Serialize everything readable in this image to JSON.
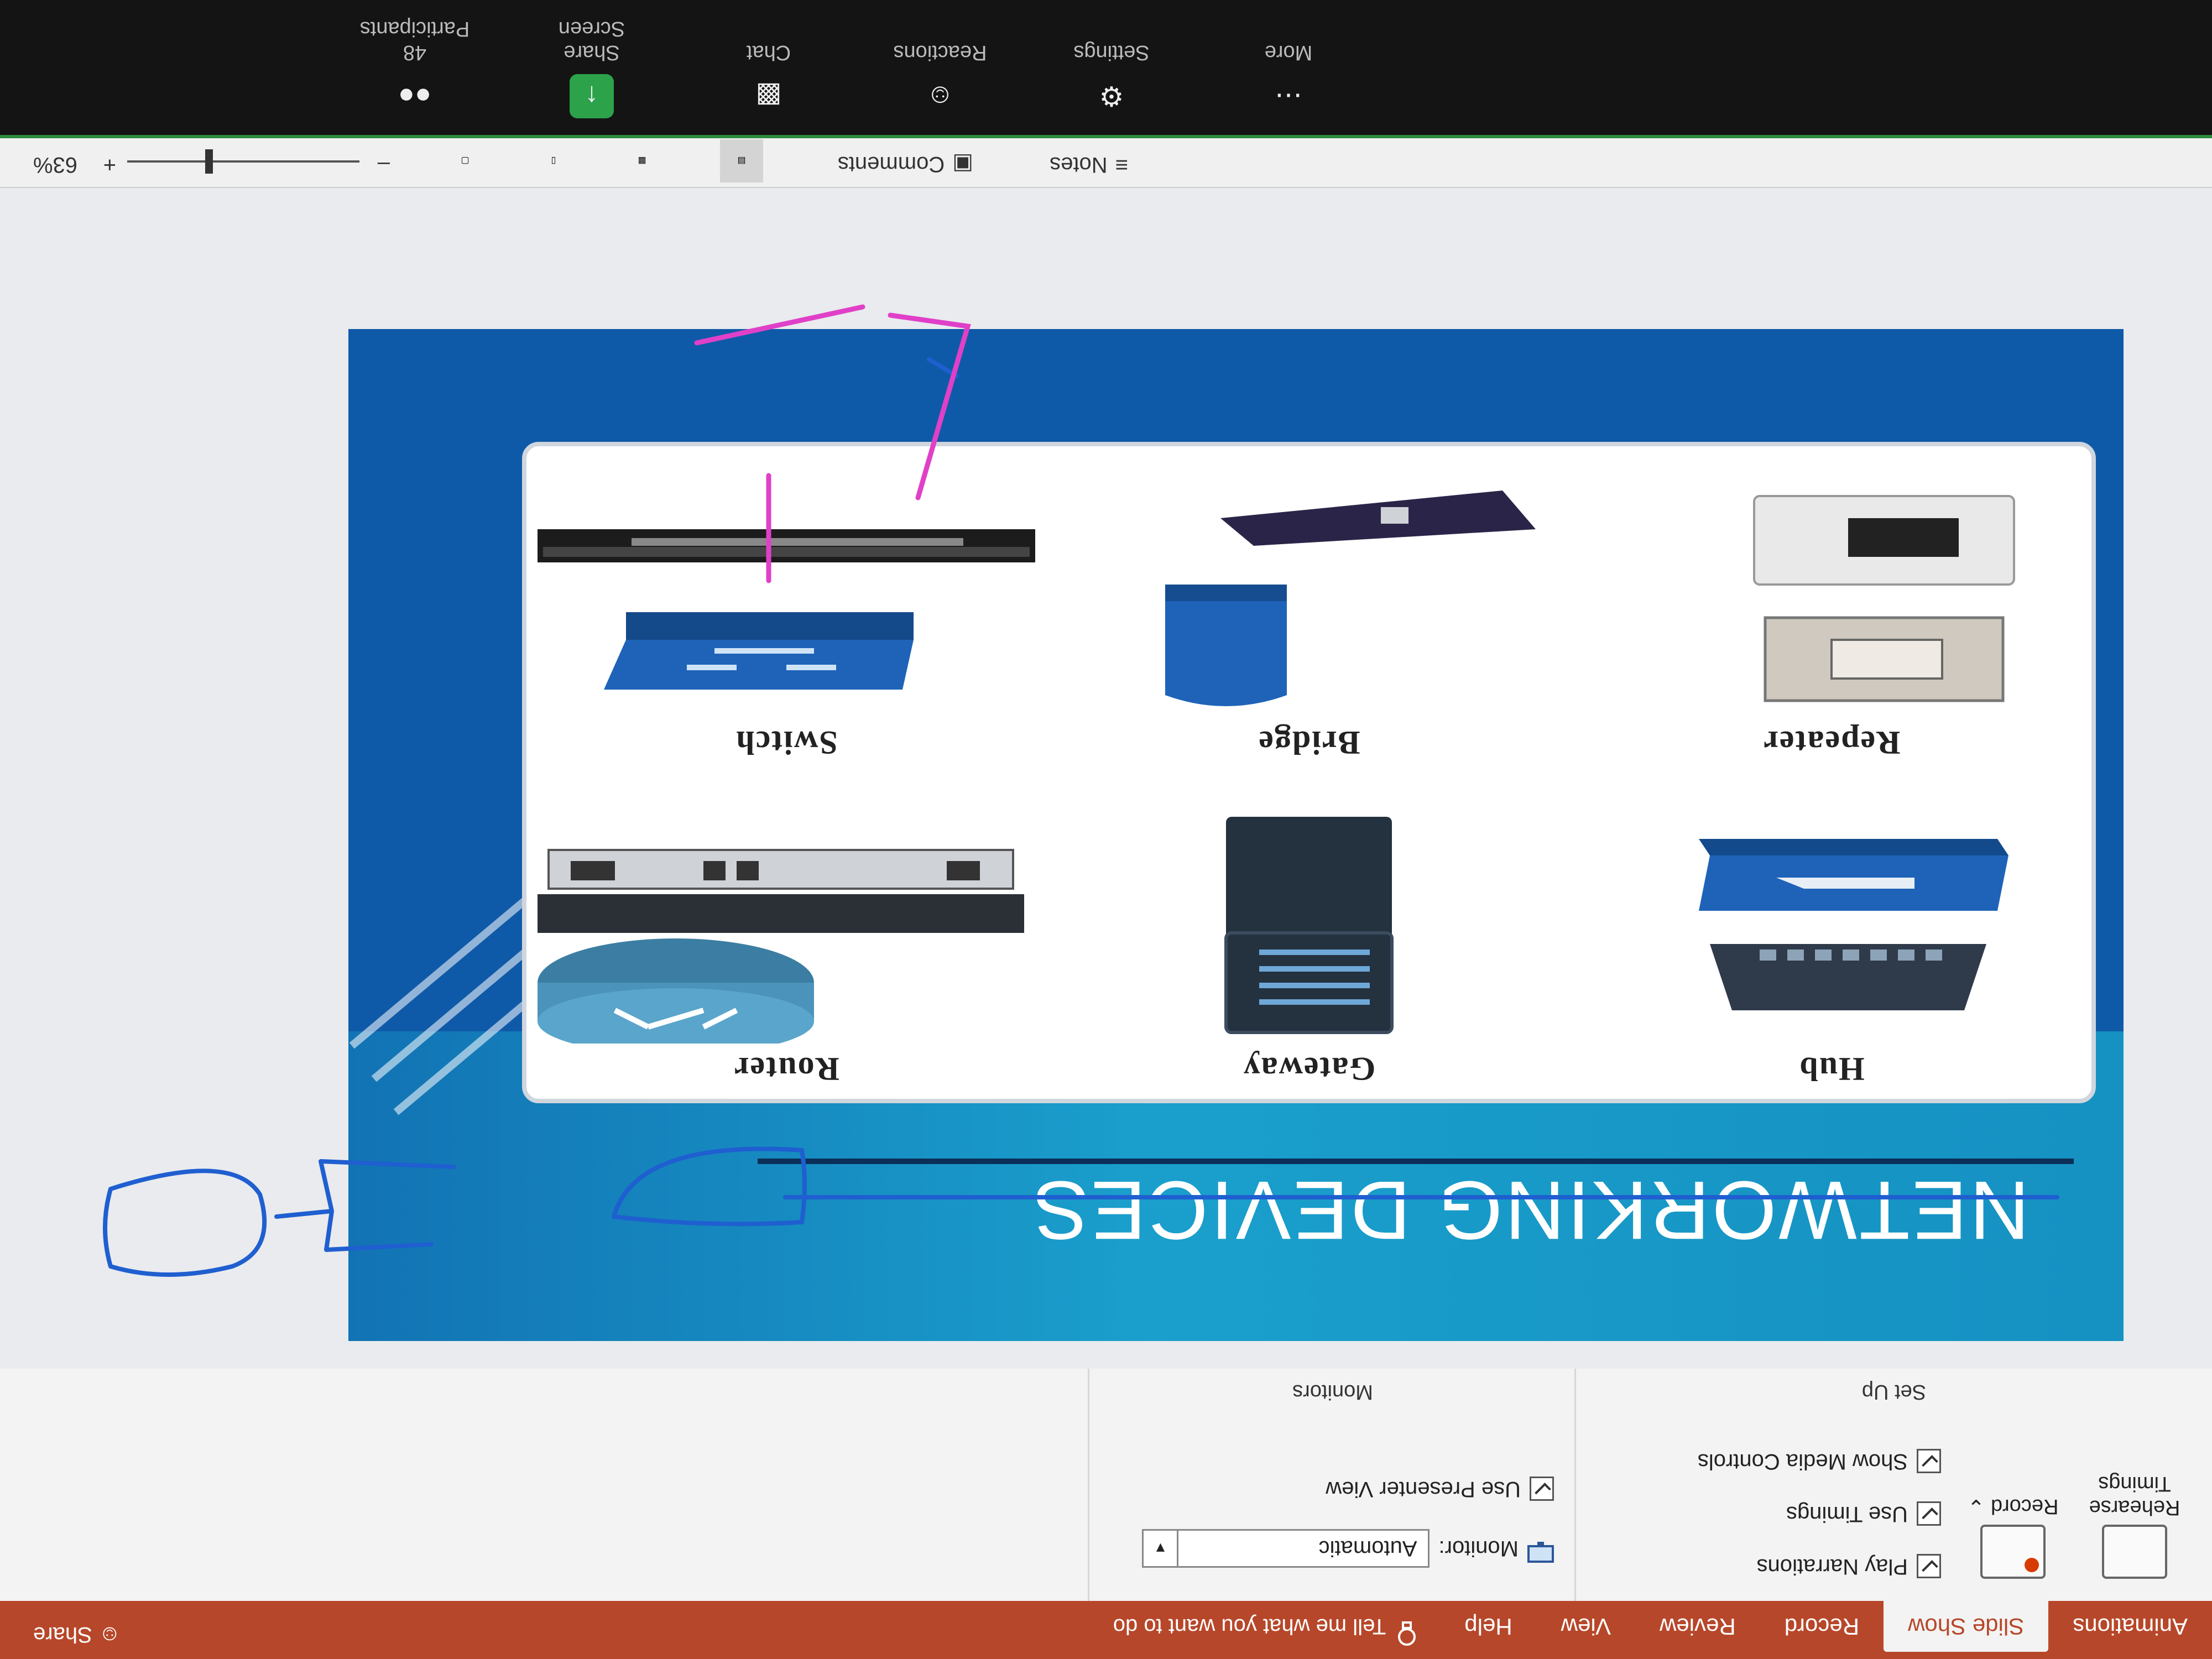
{
  "ribbon_tabs": [
    "Animations",
    "Slide Show",
    "Record",
    "Review",
    "View",
    "Help"
  ],
  "active_tab": "Slide Show",
  "tell_me": "Tell me what you want to do",
  "share": "Share",
  "setup": {
    "rehearse_label": "Rehearse Timings",
    "record_label": "Record",
    "play_narrations": "Play Narrations",
    "use_timings": "Use Timings",
    "show_media_controls": "Show Media Controls",
    "group_label": "Set Up"
  },
  "monitors": {
    "monitor_label": "Monitor:",
    "monitor_value": "Automatic",
    "presenter_view": "Use Presenter View",
    "group_label": "Monitors"
  },
  "slide": {
    "title": "NETWORKING DEVICES",
    "devices": [
      {
        "label": "Hub"
      },
      {
        "label": "Gateway"
      },
      {
        "label": "Router"
      },
      {
        "label": "Repeater"
      },
      {
        "label": "Bridge"
      },
      {
        "label": "Switch"
      }
    ]
  },
  "statusbar": {
    "notes": "Notes",
    "comments": "Comments",
    "zoom_minus": "–",
    "zoom_plus": "+",
    "zoom_value": "63%",
    "zoom_level": 0.63
  },
  "meeting_bar": {
    "items": [
      {
        "label": "Participants",
        "badge": "48",
        "icon": "participants-icon"
      },
      {
        "label": "Share Screen",
        "icon": "share-screen-icon"
      },
      {
        "label": "Chat",
        "icon": "chat-icon"
      },
      {
        "label": "Reactions",
        "icon": "reactions-icon"
      },
      {
        "label": "Settings",
        "icon": "settings-icon"
      },
      {
        "label": "More",
        "icon": "more-icon"
      }
    ]
  },
  "colors": {
    "ribbon_red": "#b7472a",
    "slide_blue": "#0f5aa8",
    "slide_band": "#1a9fcc",
    "meeting_green": "#2d8c3c",
    "ink_blue": "#1f5fd0",
    "ink_magenta": "#e040c8"
  }
}
